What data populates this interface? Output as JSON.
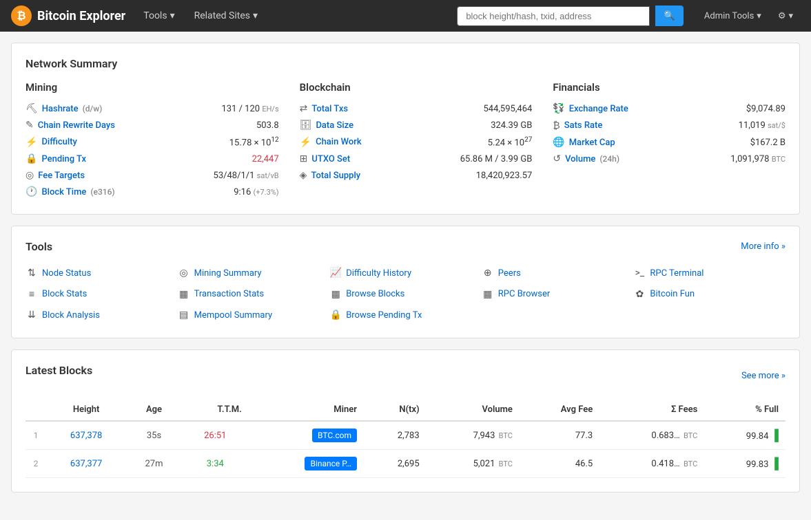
{
  "navbar": {
    "brand": "Bitcoin Explorer",
    "brand_icon": "₿",
    "tools_label": "Tools",
    "related_sites_label": "Related Sites",
    "search_placeholder": "block height/hash, txid, address",
    "admin_tools_label": "Admin Tools",
    "settings_label": "⚙"
  },
  "network_summary": {
    "title": "Network Summary",
    "mining": {
      "title": "Mining",
      "rows": [
        {
          "label": "Hashrate",
          "sublabel": "(d/w)",
          "value": "131 / 120 EH/s"
        },
        {
          "label": "Chain Rewrite Days",
          "sublabel": "",
          "value": "503.8"
        },
        {
          "label": "Difficulty",
          "sublabel": "",
          "value": "15.78 × 10¹²"
        },
        {
          "label": "Pending Tx",
          "sublabel": "",
          "value": "22,447",
          "red": true
        },
        {
          "label": "Fee Targets",
          "sublabel": "",
          "value": "53/48/1/1 sat/vB"
        },
        {
          "label": "Block Time",
          "sublabel": "(e316)",
          "value": "9:16 (+7.3%)"
        }
      ]
    },
    "blockchain": {
      "title": "Blockchain",
      "rows": [
        {
          "label": "Total Txs",
          "value": "544,595,464"
        },
        {
          "label": "Data Size",
          "value": "324.39 GB"
        },
        {
          "label": "Chain Work",
          "value": "5.24 × 10²⁷"
        },
        {
          "label": "UTXO Set",
          "value": "65.86 M / 3.99 GB"
        },
        {
          "label": "Total Supply",
          "value": "18,420,923.57"
        }
      ]
    },
    "financials": {
      "title": "Financials",
      "rows": [
        {
          "label": "Exchange Rate",
          "value": "$9,074.89"
        },
        {
          "label": "Sats Rate",
          "value": "11,019 sat/$"
        },
        {
          "label": "Market Cap",
          "value": "$167.2 B"
        },
        {
          "label": "Volume (24h)",
          "value": "1,091,978 BTC"
        }
      ]
    }
  },
  "tools": {
    "title": "Tools",
    "more_info": "More info »",
    "items": [
      {
        "label": "Node Status",
        "icon": "⇅"
      },
      {
        "label": "Block Stats",
        "icon": "≡"
      },
      {
        "label": "Block Analysis",
        "icon": "⇊"
      },
      {
        "label": "Mining Summary",
        "icon": "◎"
      },
      {
        "label": "Transaction Stats",
        "icon": "▦"
      },
      {
        "label": "Mempool Summary",
        "icon": "▤"
      },
      {
        "label": "Difficulty History",
        "icon": "📈"
      },
      {
        "label": "Browse Blocks",
        "icon": "▦"
      },
      {
        "label": "Browse Pending Tx",
        "icon": "🔒"
      },
      {
        "label": "Peers",
        "icon": "⊕"
      },
      {
        "label": "RPC Browser",
        "icon": "▦"
      },
      {
        "label": "RPC Terminal",
        "icon": ">_"
      },
      {
        "label": "Bitcoin Fun",
        "icon": "✿"
      }
    ]
  },
  "latest_blocks": {
    "title": "Latest Blocks",
    "see_more": "See more »",
    "columns": [
      "",
      "Height",
      "Age",
      "T.T.M.",
      "Miner",
      "N(tx)",
      "Volume",
      "Avg Fee",
      "Σ Fees",
      "% Full"
    ],
    "rows": [
      {
        "num": "1",
        "height": "637,378",
        "age": "35s",
        "ttm": "26:51",
        "ttm_type": "red",
        "miner": "BTC.com",
        "ntx": "2,783",
        "volume": "7,943",
        "volume_unit": "BTC",
        "avg_fee": "77.3",
        "fees": "0.683…",
        "fees_unit": "BTC",
        "pct_full": "99.84"
      },
      {
        "num": "2",
        "height": "637,377",
        "age": "27m",
        "ttm": "3:34",
        "ttm_type": "green",
        "miner": "Binance P…",
        "ntx": "2,695",
        "volume": "5,021",
        "volume_unit": "BTC",
        "avg_fee": "46.5",
        "fees": "0.418…",
        "fees_unit": "BTC",
        "pct_full": "99.83"
      }
    ]
  }
}
